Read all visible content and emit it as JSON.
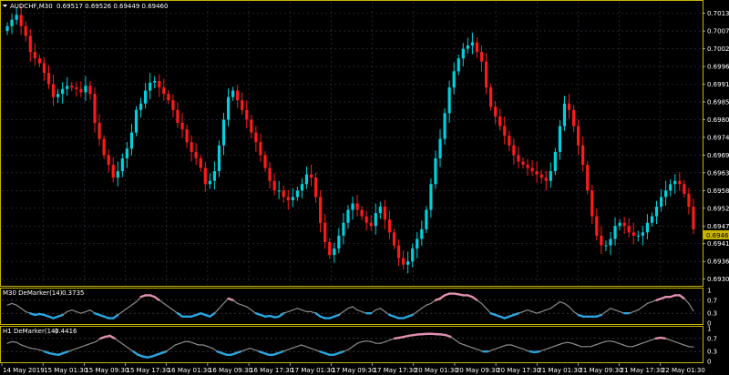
{
  "main_chart": {
    "symbol_label": "AUDCHF,M30",
    "ohlc": "0.69517 0.69526 0.69449 0.69460",
    "current_price": "0.69460",
    "price_ticks": [
      "0.70130",
      "0.70075",
      "0.70020",
      "0.69965",
      "0.69910",
      "0.69855",
      "0.69800",
      "0.69745",
      "0.69690",
      "0.69635",
      "0.69580",
      "0.69525",
      "0.69470",
      "0.69415",
      "0.69360",
      "0.69305"
    ],
    "ylim": [
      0.6929,
      0.7016
    ],
    "grid": true,
    "colors": {
      "bull": "#00d0e0",
      "bear": "#ff1a1a",
      "grid": "#3a3a50",
      "frame": "#c8b400",
      "price_box": "#c8b400"
    }
  },
  "indicator_m30": {
    "label": "M30 DeMarker(14)",
    "value": "0.3735",
    "levels": [
      "1",
      "0.7",
      "0.3",
      "0"
    ]
  },
  "indicator_h1": {
    "label": "H1 DeMarker(14)",
    "value": "0.4416",
    "levels": [
      "1",
      "0.7",
      "0.3",
      "0"
    ]
  },
  "time_axis": [
    "14 May 2019",
    "15 May 01:30",
    "15 May 09:30",
    "15 May 17:30",
    "16 May 01:30",
    "16 May 09:30",
    "16 May 17:30",
    "17 May 01:30",
    "17 May 09:30",
    "17 May 17:30",
    "20 May 01:30",
    "20 May 09:30",
    "20 May 17:30",
    "21 May 01:30",
    "21 May 09:30",
    "21 May 17:30",
    "22 May 01:30"
  ],
  "chart_data": {
    "type": "candlestick",
    "ylim": [
      0.6929,
      0.7016
    ],
    "close": [
      0.7009,
      0.7011,
      0.70125,
      0.7009,
      0.7006,
      0.7001,
      0.6999,
      0.69975,
      0.69945,
      0.6991,
      0.6987,
      0.6988,
      0.69895,
      0.69905,
      0.699,
      0.69895,
      0.69885,
      0.69905,
      0.6988,
      0.6979,
      0.6974,
      0.6969,
      0.6966,
      0.6962,
      0.6964,
      0.6968,
      0.6971,
      0.6976,
      0.6983,
      0.6985,
      0.6989,
      0.69915,
      0.6992,
      0.699,
      0.6988,
      0.6986,
      0.6983,
      0.6979,
      0.6977,
      0.6973,
      0.697,
      0.6968,
      0.6965,
      0.696,
      0.6961,
      0.6964,
      0.6972,
      0.698,
      0.6987,
      0.6989,
      0.6986,
      0.6983,
      0.698,
      0.6976,
      0.6973,
      0.6969,
      0.6965,
      0.6961,
      0.6958,
      0.6958,
      0.6956,
      0.6955,
      0.6956,
      0.6958,
      0.696,
      0.6963,
      0.6962,
      0.6956,
      0.6948,
      0.6942,
      0.6938,
      0.694,
      0.6944,
      0.6948,
      0.6952,
      0.6954,
      0.6952,
      0.695,
      0.6948,
      0.6947,
      0.6951,
      0.6953,
      0.6949,
      0.6945,
      0.6941,
      0.6937,
      0.6935,
      0.6936,
      0.694,
      0.6943,
      0.6946,
      0.6952,
      0.696,
      0.6968,
      0.6974,
      0.6982,
      0.699,
      0.6995,
      0.6999,
      0.7002,
      0.7003,
      0.7004,
      0.7001,
      0.6998,
      0.699,
      0.6984,
      0.6981,
      0.6978,
      0.6975,
      0.6972,
      0.6969,
      0.6967,
      0.6966,
      0.6965,
      0.6964,
      0.6963,
      0.6962,
      0.6961,
      0.6964,
      0.697,
      0.6978,
      0.6985,
      0.6983,
      0.6978,
      0.6972,
      0.6966,
      0.6958,
      0.695,
      0.6944,
      0.6941,
      0.6941,
      0.6943,
      0.6947,
      0.6948,
      0.6947,
      0.6945,
      0.6944,
      0.6944,
      0.6945,
      0.6948,
      0.695,
      0.6953,
      0.6956,
      0.6958,
      0.696,
      0.6961,
      0.696,
      0.6957,
      0.6953,
      0.6946
    ],
    "demarker_m30": [
      0.55,
      0.6,
      0.55,
      0.45,
      0.35,
      0.3,
      0.25,
      0.28,
      0.25,
      0.2,
      0.15,
      0.2,
      0.25,
      0.35,
      0.4,
      0.35,
      0.3,
      0.35,
      0.4,
      0.3,
      0.25,
      0.2,
      0.15,
      0.15,
      0.25,
      0.35,
      0.45,
      0.55,
      0.65,
      0.8,
      0.85,
      0.85,
      0.8,
      0.7,
      0.6,
      0.5,
      0.4,
      0.3,
      0.2,
      0.2,
      0.2,
      0.25,
      0.3,
      0.25,
      0.2,
      0.3,
      0.45,
      0.6,
      0.75,
      0.7,
      0.6,
      0.55,
      0.5,
      0.4,
      0.3,
      0.25,
      0.2,
      0.22,
      0.18,
      0.2,
      0.3,
      0.35,
      0.4,
      0.45,
      0.4,
      0.35,
      0.35,
      0.3,
      0.2,
      0.15,
      0.15,
      0.2,
      0.25,
      0.35,
      0.45,
      0.5,
      0.4,
      0.35,
      0.3,
      0.3,
      0.4,
      0.45,
      0.35,
      0.25,
      0.2,
      0.15,
      0.15,
      0.2,
      0.25,
      0.35,
      0.45,
      0.55,
      0.6,
      0.7,
      0.75,
      0.85,
      0.9,
      0.9,
      0.88,
      0.85,
      0.85,
      0.8,
      0.7,
      0.6,
      0.45,
      0.3,
      0.25,
      0.2,
      0.15,
      0.2,
      0.25,
      0.3,
      0.35,
      0.4,
      0.35,
      0.3,
      0.35,
      0.4,
      0.45,
      0.55,
      0.65,
      0.6,
      0.5,
      0.35,
      0.25,
      0.2,
      0.2,
      0.2,
      0.2,
      0.25,
      0.35,
      0.45,
      0.4,
      0.35,
      0.3,
      0.3,
      0.35,
      0.4,
      0.5,
      0.6,
      0.65,
      0.7,
      0.75,
      0.8,
      0.8,
      0.85,
      0.85,
      0.75,
      0.6,
      0.37
    ],
    "demarker_h1": [
      0.55,
      0.6,
      0.58,
      0.5,
      0.45,
      0.4,
      0.38,
      0.35,
      0.3,
      0.25,
      0.22,
      0.2,
      0.25,
      0.3,
      0.35,
      0.4,
      0.45,
      0.5,
      0.55,
      0.6,
      0.7,
      0.75,
      0.78,
      0.7,
      0.6,
      0.5,
      0.4,
      0.3,
      0.2,
      0.15,
      0.12,
      0.15,
      0.2,
      0.25,
      0.3,
      0.4,
      0.5,
      0.55,
      0.6,
      0.6,
      0.55,
      0.5,
      0.5,
      0.45,
      0.4,
      0.3,
      0.25,
      0.2,
      0.2,
      0.25,
      0.3,
      0.35,
      0.4,
      0.35,
      0.3,
      0.25,
      0.2,
      0.2,
      0.25,
      0.3,
      0.35,
      0.4,
      0.45,
      0.5,
      0.45,
      0.4,
      0.35,
      0.3,
      0.25,
      0.2,
      0.2,
      0.25,
      0.3,
      0.35,
      0.45,
      0.55,
      0.6,
      0.62,
      0.6,
      0.55,
      0.55,
      0.6,
      0.65,
      0.7,
      0.72,
      0.75,
      0.78,
      0.8,
      0.82,
      0.83,
      0.84,
      0.84,
      0.83,
      0.82,
      0.8,
      0.75,
      0.65,
      0.55,
      0.5,
      0.45,
      0.4,
      0.35,
      0.3,
      0.3,
      0.35,
      0.4,
      0.45,
      0.5,
      0.5,
      0.45,
      0.4,
      0.35,
      0.3,
      0.28,
      0.3,
      0.35,
      0.4,
      0.45,
      0.5,
      0.55,
      0.58,
      0.55,
      0.5,
      0.45,
      0.45,
      0.45,
      0.5,
      0.55,
      0.6,
      0.62,
      0.6,
      0.55,
      0.5,
      0.45,
      0.45,
      0.5,
      0.55,
      0.6,
      0.65,
      0.7,
      0.72,
      0.7,
      0.65,
      0.6,
      0.55,
      0.5,
      0.45,
      0.44
    ]
  }
}
